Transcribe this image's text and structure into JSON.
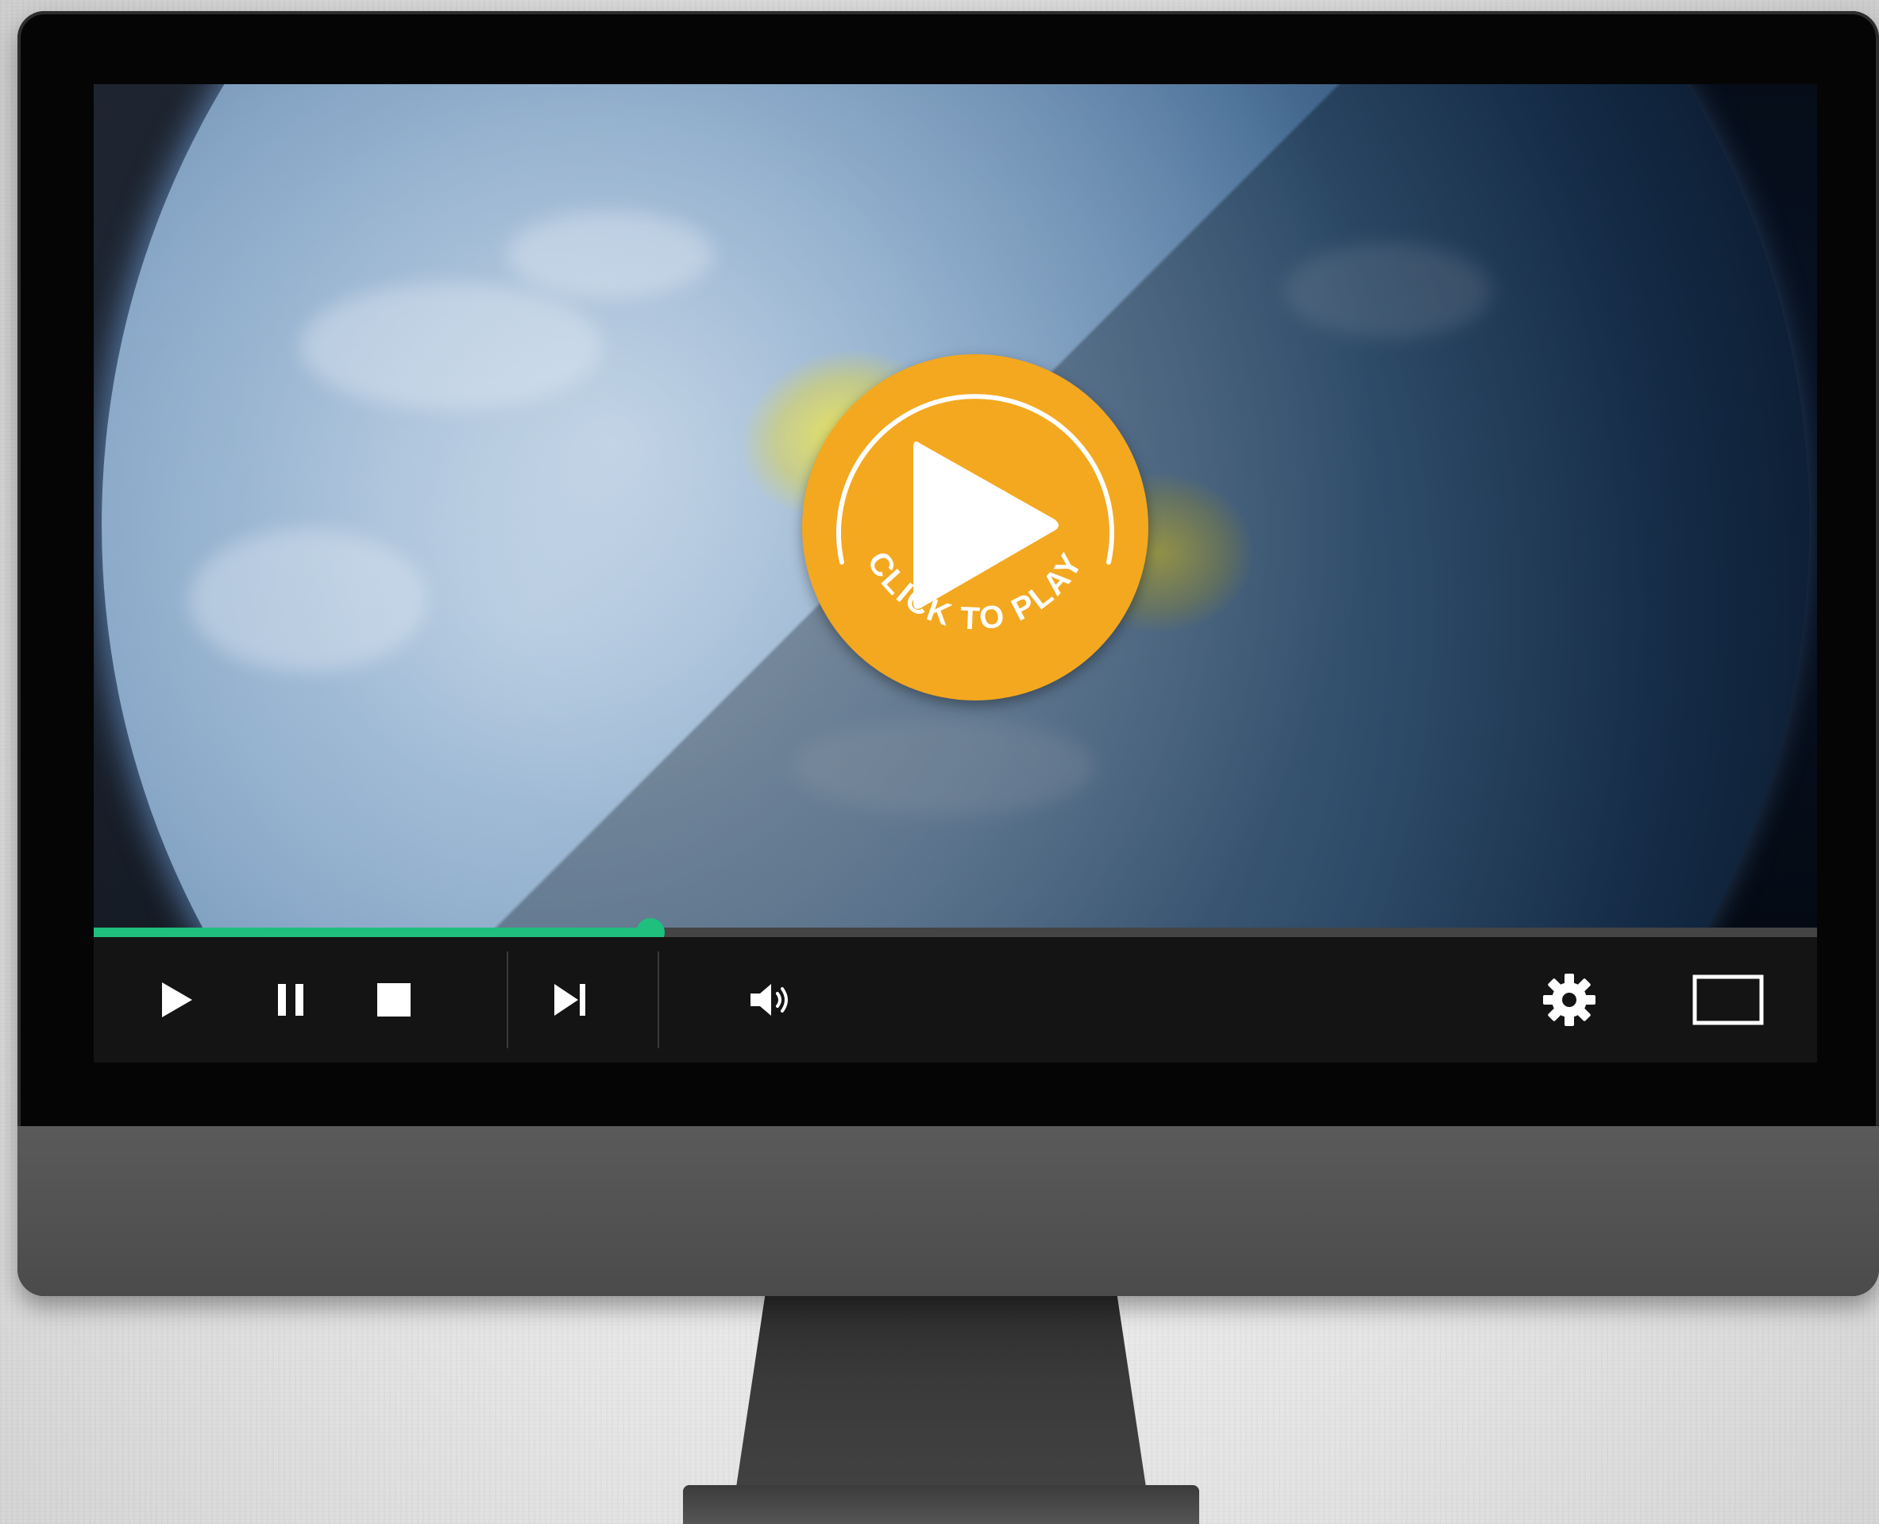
{
  "player": {
    "overlay_label": "CLICK TO PLAY",
    "progress": 0.323,
    "accent_color": "#1fbf7d",
    "play_badge_color": "#f4a81f"
  },
  "controls": {
    "icons": [
      "play-icon",
      "pause-icon",
      "stop-icon",
      "skip-next-icon",
      "volume-icon",
      "gear-icon",
      "fullscreen-icon"
    ]
  }
}
